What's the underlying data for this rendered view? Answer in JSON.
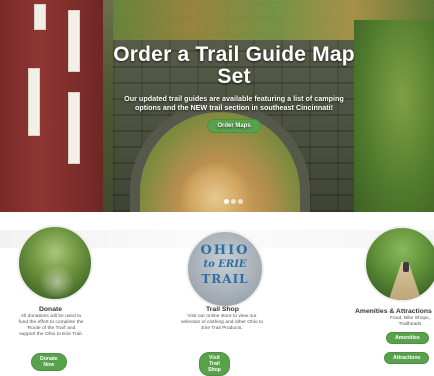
{
  "hero": {
    "title": "Order a Trail Guide Map Set",
    "subtitle": "Our updated trail guides are available featuring a list of camping options and the NEW trail section in southeast Cincinnati!",
    "button_label": "Order Maps",
    "slide_count": 3,
    "active_slide": 1
  },
  "cards": {
    "donate": {
      "title": "Donate",
      "description": "All donations will be used to fund the effort to complete the 'Route of the Trail' and support the Ohio to Erie Trail.",
      "button_label": "Donate Now"
    },
    "shop": {
      "logo_lines": [
        "OHIO",
        "to ERIE",
        "TRAIL"
      ],
      "title": "Trail Shop",
      "description": "Visit our online store to view our selection of clothing and other Ohio to Erie Trail Products.",
      "button_label": "Visit Trail Shop"
    },
    "amenities": {
      "title": "Amenities & Attractions",
      "description": "Food, Bike Shops, Trailheads",
      "button1_label": "Amenities",
      "button2_label": "Attractions"
    }
  },
  "colors": {
    "accent_green": "#59a24c"
  }
}
